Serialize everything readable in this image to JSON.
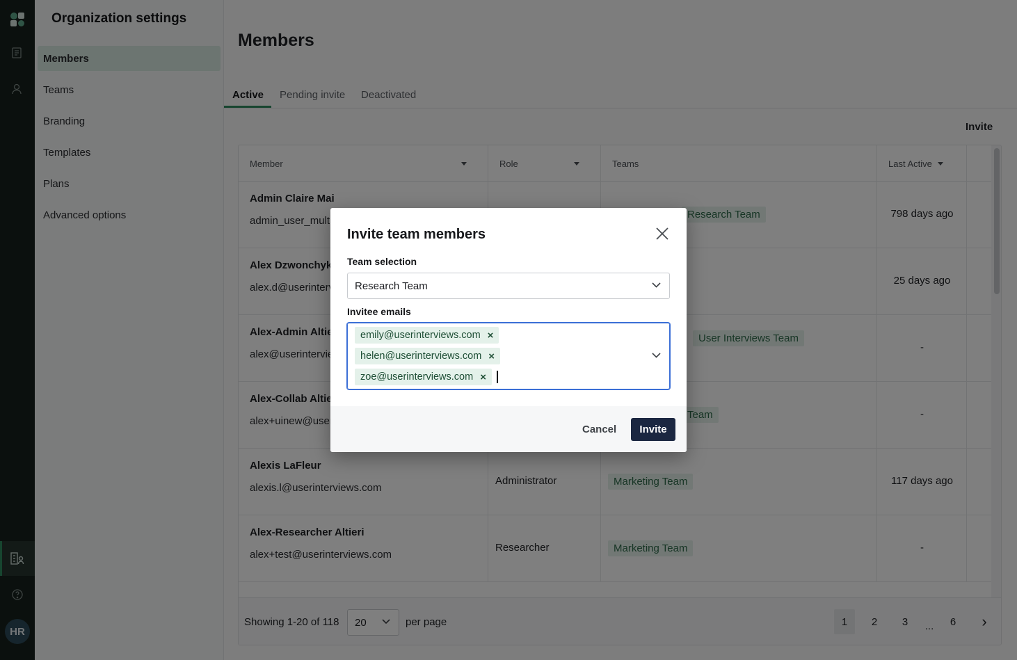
{
  "rail": {
    "avatar": "HR"
  },
  "settings": {
    "title": "Organization settings",
    "items": [
      {
        "label": "Members"
      },
      {
        "label": "Teams"
      },
      {
        "label": "Branding"
      },
      {
        "label": "Templates"
      },
      {
        "label": "Plans"
      },
      {
        "label": "Advanced options"
      }
    ]
  },
  "main": {
    "title": "Members",
    "tabs": [
      "Active",
      "Pending invite",
      "Deactivated"
    ],
    "invite_label": "Invite"
  },
  "table": {
    "headers": [
      "Member",
      "Role",
      "Teams",
      "Last Active"
    ],
    "rows": [
      {
        "name": "Admin Claire Mai",
        "email": "admin_user_multi",
        "role": "",
        "team": "Research Team",
        "last": "798 days ago"
      },
      {
        "name": "Alex Dzwonchyk",
        "email": "alex.d@userinterv",
        "role": "",
        "team": "",
        "last": "25 days ago"
      },
      {
        "name": "Alex-Admin Altie",
        "email": "alex@userintervie",
        "role": "",
        "team": "User Interviews Team",
        "last": "-"
      },
      {
        "name": "Alex-Collab Altie",
        "email": "alex+uinew@user",
        "role": "",
        "team": "Team",
        "last": "-"
      },
      {
        "name": "Alexis LaFleur",
        "email": "alexis.l@userinterviews.com",
        "role": "Administrator",
        "team": "Marketing Team",
        "last": "117 days ago"
      },
      {
        "name": "Alex-Researcher Altieri",
        "email": "alex+test@userinterviews.com",
        "role": "Researcher",
        "team": "Marketing Team",
        "last": "-"
      }
    ]
  },
  "pager": {
    "showing": "Showing 1-20 of 118",
    "per_page_value": "20",
    "per_page_label": "per page",
    "pages": [
      "1",
      "2",
      "3",
      "...",
      "6"
    ],
    "next": "›"
  },
  "modal": {
    "title": "Invite team members",
    "team_label": "Team selection",
    "team_value": "Research Team",
    "emails_label": "Invitee emails",
    "emails": [
      "emily@userinterviews.com",
      "helen@userinterviews.com",
      "zoe@userinterviews.com"
    ],
    "remove_glyph": "×",
    "cancel": "Cancel",
    "invite": "Invite"
  }
}
